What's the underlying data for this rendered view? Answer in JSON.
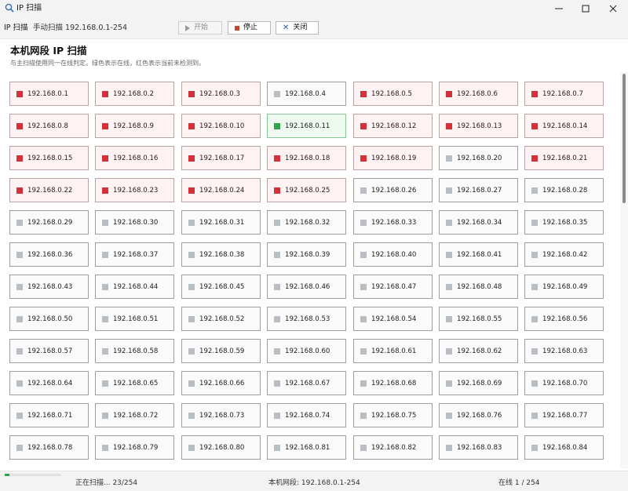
{
  "window": {
    "title": "IP 扫描",
    "icon": "magnifier-icon"
  },
  "toolbar": {
    "title": "IP 扫描",
    "mode_text": "手动扫描 192.168.0.1-254",
    "start_label": "开始",
    "stop_label": "停止",
    "close_label": "关闭"
  },
  "header": {
    "title": "本机网段 IP 扫描",
    "description": "与主扫描使用同一在线判定。绿色表示在线，红色表示当前未检测到。"
  },
  "colors": {
    "online": "#2ea44f",
    "offline": "#d3303a",
    "pending": "#b9bec5"
  },
  "cells": [
    {
      "ip": "192.168.0.1",
      "state": "offline"
    },
    {
      "ip": "192.168.0.2",
      "state": "offline"
    },
    {
      "ip": "192.168.0.3",
      "state": "offline"
    },
    {
      "ip": "192.168.0.4",
      "state": "pending"
    },
    {
      "ip": "192.168.0.5",
      "state": "offline"
    },
    {
      "ip": "192.168.0.6",
      "state": "offline"
    },
    {
      "ip": "192.168.0.7",
      "state": "offline"
    },
    {
      "ip": "192.168.0.8",
      "state": "offline"
    },
    {
      "ip": "192.168.0.9",
      "state": "offline"
    },
    {
      "ip": "192.168.0.10",
      "state": "offline"
    },
    {
      "ip": "192.168.0.11",
      "state": "online"
    },
    {
      "ip": "192.168.0.12",
      "state": "offline"
    },
    {
      "ip": "192.168.0.13",
      "state": "offline"
    },
    {
      "ip": "192.168.0.14",
      "state": "offline"
    },
    {
      "ip": "192.168.0.15",
      "state": "offline"
    },
    {
      "ip": "192.168.0.16",
      "state": "offline"
    },
    {
      "ip": "192.168.0.17",
      "state": "offline"
    },
    {
      "ip": "192.168.0.18",
      "state": "offline"
    },
    {
      "ip": "192.168.0.19",
      "state": "offline"
    },
    {
      "ip": "192.168.0.20",
      "state": "pending"
    },
    {
      "ip": "192.168.0.21",
      "state": "offline"
    },
    {
      "ip": "192.168.0.22",
      "state": "offline"
    },
    {
      "ip": "192.168.0.23",
      "state": "offline"
    },
    {
      "ip": "192.168.0.24",
      "state": "offline"
    },
    {
      "ip": "192.168.0.25",
      "state": "offline"
    },
    {
      "ip": "192.168.0.26",
      "state": "pending"
    },
    {
      "ip": "192.168.0.27",
      "state": "pending"
    },
    {
      "ip": "192.168.0.28",
      "state": "pending"
    },
    {
      "ip": "192.168.0.29",
      "state": "pending"
    },
    {
      "ip": "192.168.0.30",
      "state": "pending"
    },
    {
      "ip": "192.168.0.31",
      "state": "pending"
    },
    {
      "ip": "192.168.0.32",
      "state": "pending"
    },
    {
      "ip": "192.168.0.33",
      "state": "pending"
    },
    {
      "ip": "192.168.0.34",
      "state": "pending"
    },
    {
      "ip": "192.168.0.35",
      "state": "pending"
    },
    {
      "ip": "192.168.0.36",
      "state": "pending"
    },
    {
      "ip": "192.168.0.37",
      "state": "pending"
    },
    {
      "ip": "192.168.0.38",
      "state": "pending"
    },
    {
      "ip": "192.168.0.39",
      "state": "pending"
    },
    {
      "ip": "192.168.0.40",
      "state": "pending"
    },
    {
      "ip": "192.168.0.41",
      "state": "pending"
    },
    {
      "ip": "192.168.0.42",
      "state": "pending"
    },
    {
      "ip": "192.168.0.43",
      "state": "pending"
    },
    {
      "ip": "192.168.0.44",
      "state": "pending"
    },
    {
      "ip": "192.168.0.45",
      "state": "pending"
    },
    {
      "ip": "192.168.0.46",
      "state": "pending"
    },
    {
      "ip": "192.168.0.47",
      "state": "pending"
    },
    {
      "ip": "192.168.0.48",
      "state": "pending"
    },
    {
      "ip": "192.168.0.49",
      "state": "pending"
    },
    {
      "ip": "192.168.0.50",
      "state": "pending"
    },
    {
      "ip": "192.168.0.51",
      "state": "pending"
    },
    {
      "ip": "192.168.0.52",
      "state": "pending"
    },
    {
      "ip": "192.168.0.53",
      "state": "pending"
    },
    {
      "ip": "192.168.0.54",
      "state": "pending"
    },
    {
      "ip": "192.168.0.55",
      "state": "pending"
    },
    {
      "ip": "192.168.0.56",
      "state": "pending"
    },
    {
      "ip": "192.168.0.57",
      "state": "pending"
    },
    {
      "ip": "192.168.0.58",
      "state": "pending"
    },
    {
      "ip": "192.168.0.59",
      "state": "pending"
    },
    {
      "ip": "192.168.0.60",
      "state": "pending"
    },
    {
      "ip": "192.168.0.61",
      "state": "pending"
    },
    {
      "ip": "192.168.0.62",
      "state": "pending"
    },
    {
      "ip": "192.168.0.63",
      "state": "pending"
    },
    {
      "ip": "192.168.0.64",
      "state": "pending"
    },
    {
      "ip": "192.168.0.65",
      "state": "pending"
    },
    {
      "ip": "192.168.0.66",
      "state": "pending"
    },
    {
      "ip": "192.168.0.67",
      "state": "pending"
    },
    {
      "ip": "192.168.0.68",
      "state": "pending"
    },
    {
      "ip": "192.168.0.69",
      "state": "pending"
    },
    {
      "ip": "192.168.0.70",
      "state": "pending"
    },
    {
      "ip": "192.168.0.71",
      "state": "pending"
    },
    {
      "ip": "192.168.0.72",
      "state": "pending"
    },
    {
      "ip": "192.168.0.73",
      "state": "pending"
    },
    {
      "ip": "192.168.0.74",
      "state": "pending"
    },
    {
      "ip": "192.168.0.75",
      "state": "pending"
    },
    {
      "ip": "192.168.0.76",
      "state": "pending"
    },
    {
      "ip": "192.168.0.77",
      "state": "pending"
    },
    {
      "ip": "192.168.0.78",
      "state": "pending"
    },
    {
      "ip": "192.168.0.79",
      "state": "pending"
    },
    {
      "ip": "192.168.0.80",
      "state": "pending"
    },
    {
      "ip": "192.168.0.81",
      "state": "pending"
    },
    {
      "ip": "192.168.0.82",
      "state": "pending"
    },
    {
      "ip": "192.168.0.83",
      "state": "pending"
    },
    {
      "ip": "192.168.0.84",
      "state": "pending"
    }
  ],
  "status": {
    "progress_text": "正在扫描... 23/254",
    "progress_fraction": 0.09,
    "range_text": "本机网段: 192.168.0.1-254",
    "online_text": "在线 1 / 254"
  }
}
